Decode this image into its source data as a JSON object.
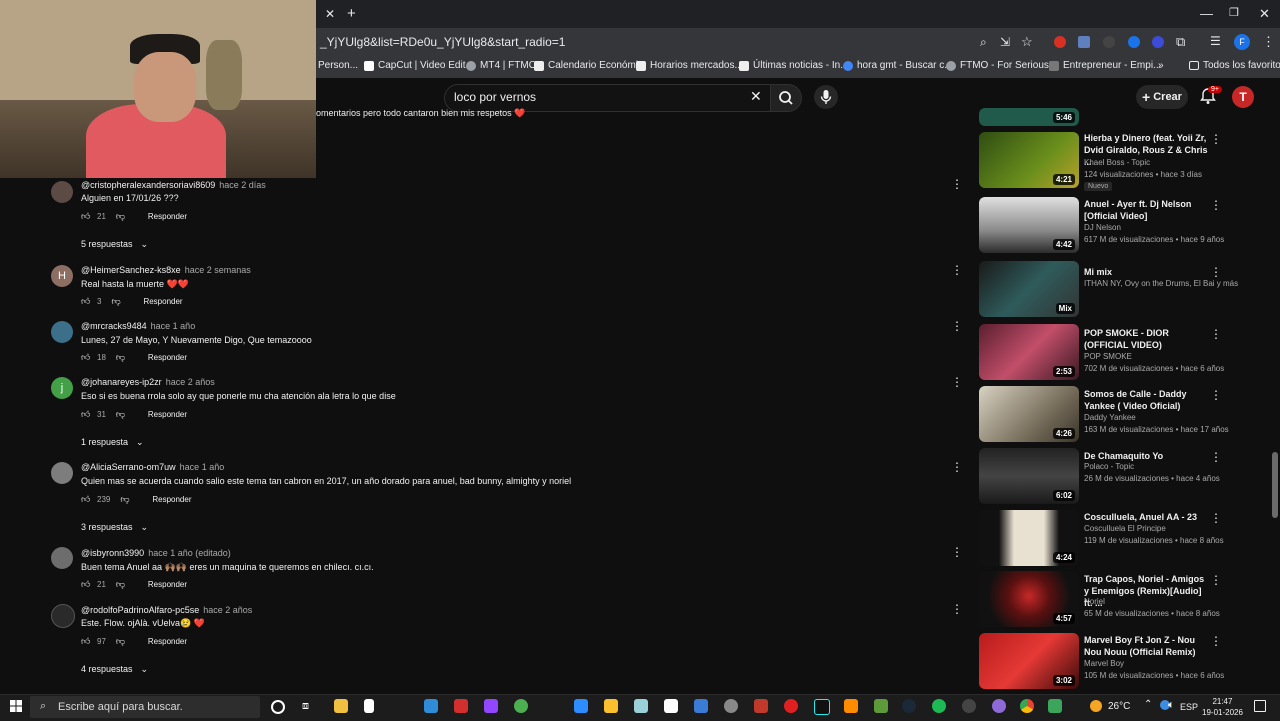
{
  "browser": {
    "url": "_YjYUlg8&list=RDe0u_YjYUlg8&start_radio=1",
    "bookmarks": [
      "Person...",
      "CapCut | Video Edit...",
      "MT4 | FTMO",
      "Calendario Económi...",
      "Horarios mercados...",
      "Últimas noticias - In...",
      "hora gmt - Buscar c...",
      "FTMO - For Serious...",
      "Entrepreneur - Empi..."
    ],
    "bookmarks_all": "Todos los favoritos",
    "profile_initial": "F"
  },
  "youtube": {
    "search_value": "loco por vernos",
    "create_label": "Crear",
    "notif_count": "9+",
    "avatar_initial": "T"
  },
  "comments": {
    "top_text": "omentarios pero todo cantaron bien mis respetos ❤️",
    "reply_label": "Responder",
    "items": [
      {
        "user": "@cristopheralexandersoriavi8609",
        "time": "hace 2 días",
        "text": "Alguien en 17/01/26 ???",
        "likes": "21",
        "replies": "5 respuestas",
        "avatar": ""
      },
      {
        "user": "@HeimerSanchez-ks8xe",
        "time": "hace 2 semanas",
        "text": "Real hasta la muerte ❤️❤️",
        "likes": "3",
        "replies": "",
        "avatar": "H"
      },
      {
        "user": "@mrcracks9484",
        "time": "hace 1 año",
        "text": "Lunes, 27 de Mayo, Y Nuevamente Digo, Que temazoooo",
        "likes": "18",
        "replies": "",
        "avatar": ""
      },
      {
        "user": "@johanareyes-ip2zr",
        "time": "hace 2 años",
        "text": "Eso si es buena rrola solo ay que ponerle mu cha atención  ala letra  lo que dise",
        "likes": "31",
        "replies": "1 respuesta",
        "avatar": "j"
      },
      {
        "user": "@AliciaSerrano-om7uw",
        "time": "hace 1 año",
        "text": "Quien mas se acuerda cuando salio este tema tan cabron en 2017, un año dorado para anuel, bad bunny, almighty y noriel",
        "likes": "239",
        "replies": "3 respuestas",
        "avatar": ""
      },
      {
        "user": "@isbyronn3990",
        "time": "hace 1 año (editado)",
        "text": "Buen tema Anuel aa 🙌🏽🙌🏽 eres un maquina te queremos en chilecı. cı.cı.",
        "likes": "21",
        "replies": "",
        "avatar": ""
      },
      {
        "user": "@rodolfoPadrinoAlfaro-pc5se",
        "time": "hace 2 años",
        "text": "Este.  Flow.  ojAlà. vUelva😢 ❤️",
        "likes": "97",
        "replies": "4 respuestas",
        "avatar": ""
      }
    ]
  },
  "sidebar": {
    "videos": [
      {
        "title": "",
        "channel": "",
        "meta": "",
        "duration": "5:46"
      },
      {
        "title": "Hierba y Dinero (feat. Yoii Zr, Dvid Giraldo, Rous Z & Chris ...",
        "channel": "Khael Boss - Topic",
        "meta": "124 visualizaciones • hace 3 días",
        "duration": "4:21",
        "badge": "Nuevo"
      },
      {
        "title": "Anuel - Ayer ft. Dj Nelson [Official Video]",
        "channel": "DJ Nelson",
        "meta": "617 M de visualizaciones • hace 9 años",
        "duration": "4:42"
      },
      {
        "title": "Mi mix",
        "channel": "ITHAN NY, Ovy on the Drums, El Bai y más",
        "meta": "",
        "duration": "Mix"
      },
      {
        "title": "POP SMOKE - DIOR (OFFICIAL VIDEO)",
        "channel": "POP SMOKE",
        "meta": "702 M de visualizaciones • hace 6 años",
        "duration": "2:53"
      },
      {
        "title": "Somos de Calle - Daddy Yankee ( Video Oficial)",
        "channel": "Daddy Yankee",
        "meta": "163 M de visualizaciones • hace 17 años",
        "duration": "4:26"
      },
      {
        "title": "De Chamaquito Yo",
        "channel": "Polaco - Topic",
        "meta": "26 M de visualizaciones • hace 4 años",
        "duration": "6:02"
      },
      {
        "title": "Cosculluela, Anuel AA - 23",
        "channel": "Cosculluela El Principe",
        "meta": "119 M de visualizaciones • hace 8 años",
        "duration": "4:24"
      },
      {
        "title": "Trap Capos, Noriel - Amigos y Enemigos (Remix)[Audio] ft. ...",
        "channel": "Noriel",
        "meta": "65 M de visualizaciones • hace 8 años",
        "duration": "4:57"
      },
      {
        "title": "Marvel Boy Ft Jon Z - Nou Nou Nouu (Official Remix)",
        "channel": "Marvel Boy",
        "meta": "105 M de visualizaciones • hace 6 años",
        "duration": "3:02"
      }
    ]
  },
  "taskbar": {
    "search_placeholder": "Escribe aquí para buscar.",
    "temperature": "26°C",
    "language": "ESP",
    "time": "21:47",
    "date": "19-01-2026"
  },
  "colors": {
    "bg": "#0f0f0f",
    "accent_red": "#ff0000",
    "avatar_red": "#c62828"
  }
}
